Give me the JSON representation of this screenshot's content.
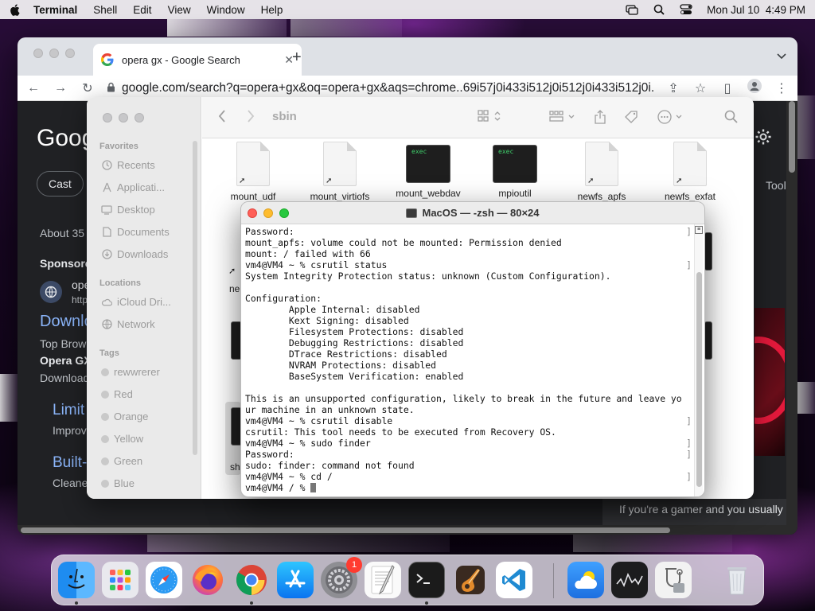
{
  "menubar": {
    "app_name": "Terminal",
    "items": [
      "Shell",
      "Edit",
      "View",
      "Window",
      "Help"
    ],
    "clock": "Mon Jul 10  4:49 PM"
  },
  "chrome": {
    "tab_title": "opera gx - Google Search",
    "url": "google.com/search?q=opera+gx&oq=opera+gx&aqs=chrome..69i57j0i433i512j0i512j0i433i512j0i...",
    "page": {
      "logo": "Goog",
      "cast_chip": "Cast",
      "about": "About 35",
      "sponsored": "Sponsore",
      "ad_name": "ope",
      "ad_url": "http",
      "download_link": "Downlo",
      "top_browser": "Top Brow",
      "opera_gx": "Opera GX",
      "download_text": "Download",
      "limit_link": "Limit",
      "improve": "Improv",
      "builtin_link": "Built-",
      "cleaner": "Cleane",
      "tools": "Tool",
      "gamer_text": "If you're a gamer and you usually"
    }
  },
  "finder": {
    "title": "sbin",
    "favorites_title": "Favorites",
    "favorites": [
      {
        "label": "Recents",
        "icon": "clock-icon"
      },
      {
        "label": "Applicati...",
        "icon": "applications-icon"
      },
      {
        "label": "Desktop",
        "icon": "desktop-icon"
      },
      {
        "label": "Documents",
        "icon": "document-icon"
      },
      {
        "label": "Downloads",
        "icon": "download-icon"
      }
    ],
    "locations_title": "Locations",
    "locations": [
      {
        "label": "iCloud Dri...",
        "icon": "cloud-icon"
      },
      {
        "label": "Network",
        "icon": "globe-icon"
      }
    ],
    "tags_title": "Tags",
    "tags": [
      "rewwrerer",
      "Red",
      "Orange",
      "Yellow",
      "Green",
      "Blue"
    ],
    "files": [
      {
        "name": "mount_udf",
        "kind": "alias"
      },
      {
        "name": "mount_virtiofs",
        "kind": "alias"
      },
      {
        "name": "mount_webdav",
        "kind": "exec"
      },
      {
        "name": "mpioutil",
        "kind": "exec"
      },
      {
        "name": "newfs_apfs",
        "kind": "alias"
      },
      {
        "name": "newfs_exfat",
        "kind": "alias"
      }
    ],
    "exec_label": "exec",
    "partial_labels": {
      "ne": "ne",
      "sh": "sh"
    }
  },
  "terminal": {
    "title": "MacOS — -zsh — 80×24",
    "lines": [
      {
        "text": "Password:",
        "bracket": true
      },
      {
        "text": "mount_apfs: volume could not be mounted: Permission denied",
        "bracket": false
      },
      {
        "text": "mount: / failed with 66",
        "bracket": false
      },
      {
        "text": "vm4@VM4 ~ % csrutil status",
        "bracket": true
      },
      {
        "text": "System Integrity Protection status: unknown (Custom Configuration).",
        "bracket": false
      },
      {
        "text": "",
        "bracket": false
      },
      {
        "text": "Configuration:",
        "bracket": false
      },
      {
        "text": "        Apple Internal: disabled",
        "bracket": false
      },
      {
        "text": "        Kext Signing: disabled",
        "bracket": false
      },
      {
        "text": "        Filesystem Protections: disabled",
        "bracket": false
      },
      {
        "text": "        Debugging Restrictions: disabled",
        "bracket": false
      },
      {
        "text": "        DTrace Restrictions: disabled",
        "bracket": false
      },
      {
        "text": "        NVRAM Protections: disabled",
        "bracket": false
      },
      {
        "text": "        BaseSystem Verification: enabled",
        "bracket": false
      },
      {
        "text": "",
        "bracket": false
      },
      {
        "text": "This is an unsupported configuration, likely to break in the future and leave yo",
        "bracket": false
      },
      {
        "text": "ur machine in an unknown state.",
        "bracket": false
      },
      {
        "text": "vm4@VM4 ~ % csrutil disable",
        "bracket": true
      },
      {
        "text": "csrutil: This tool needs to be executed from Recovery OS.",
        "bracket": false
      },
      {
        "text": "vm4@VM4 ~ % sudo finder",
        "bracket": true
      },
      {
        "text": "Password:",
        "bracket": true
      },
      {
        "text": "sudo: finder: command not found",
        "bracket": false
      },
      {
        "text": "vm4@VM4 ~ % cd /",
        "bracket": true
      },
      {
        "text": "vm4@VM4 / % ",
        "bracket": false
      }
    ]
  },
  "dock": {
    "apps": [
      {
        "name": "finder",
        "running": true
      },
      {
        "name": "launchpad",
        "running": false
      },
      {
        "name": "safari",
        "running": false
      },
      {
        "name": "firefox",
        "running": false
      },
      {
        "name": "chrome",
        "running": true
      },
      {
        "name": "app-store",
        "running": false
      },
      {
        "name": "system-settings",
        "running": false,
        "badge": "1"
      },
      {
        "name": "textedit",
        "running": false
      },
      {
        "name": "terminal",
        "running": true
      },
      {
        "name": "garageband",
        "running": false
      },
      {
        "name": "vscode",
        "running": false
      },
      {
        "name": "weather",
        "running": false
      },
      {
        "name": "stocks",
        "running": false
      },
      {
        "name": "disk-utility",
        "running": false
      },
      {
        "name": "trash",
        "running": false
      }
    ]
  },
  "colors": {
    "terminal_bg": "#ffffff",
    "exec_text": "#3fd06b",
    "google_bg": "#202124",
    "link_blue": "#8ab4f8"
  }
}
